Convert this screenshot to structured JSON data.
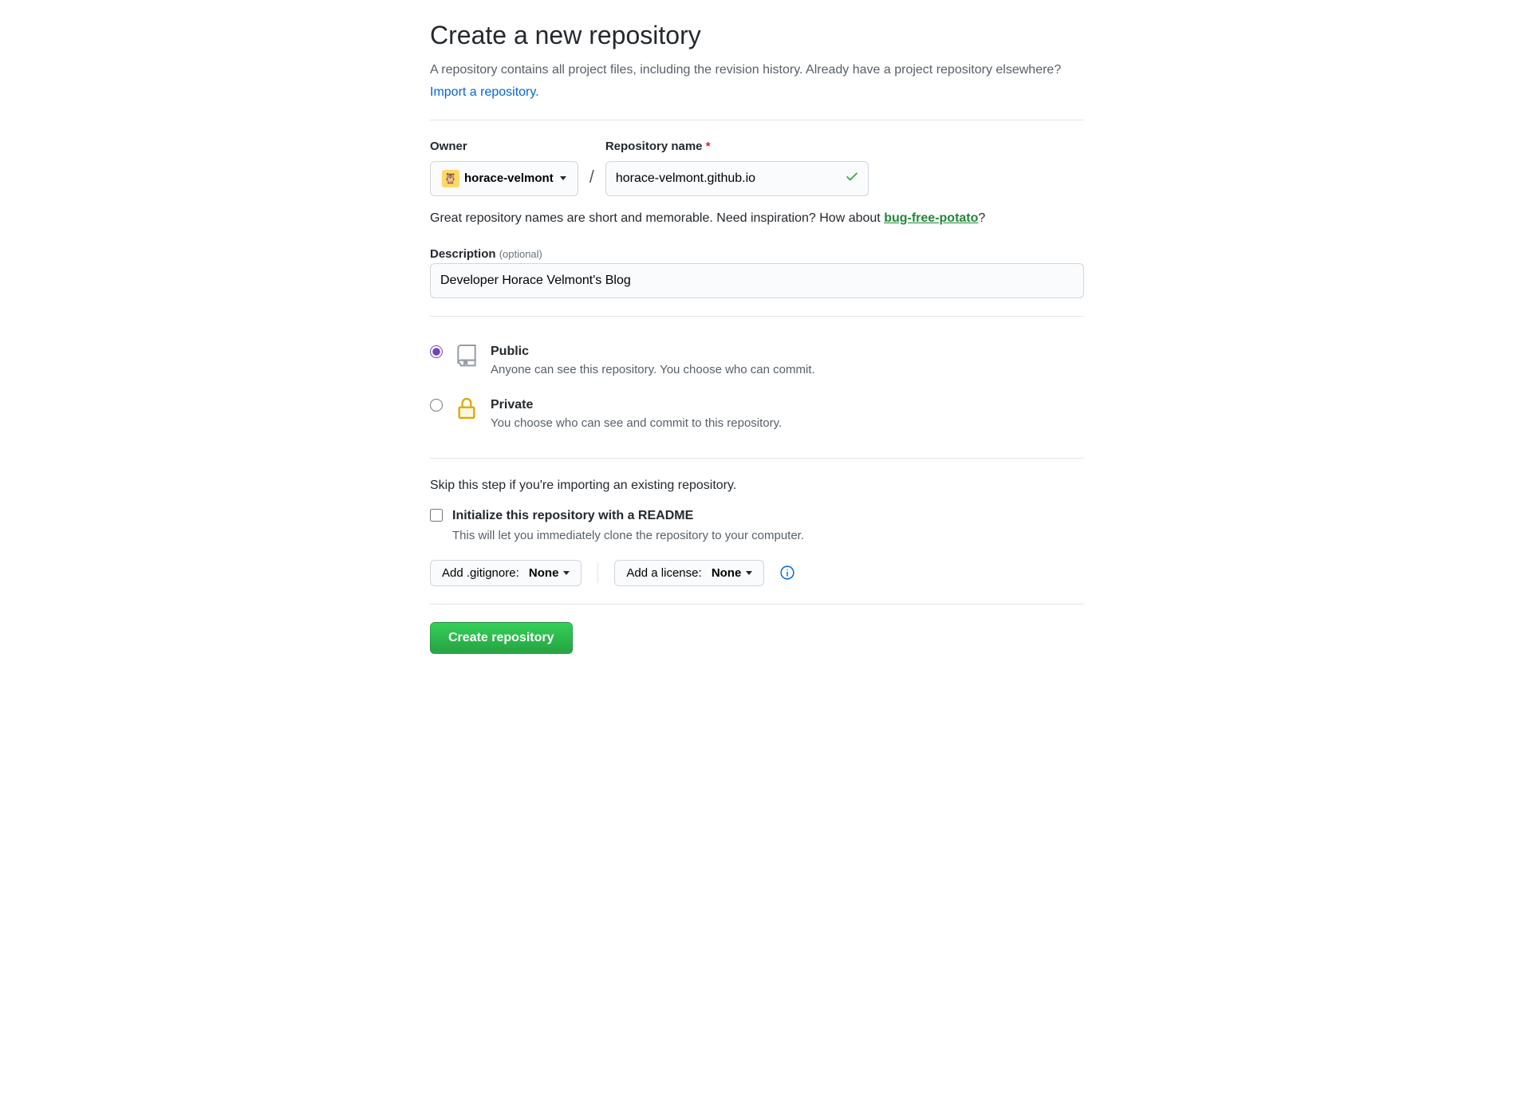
{
  "page": {
    "title": "Create a new repository",
    "subtitle": "A repository contains all project files, including the revision history. Already have a project repository elsewhere?",
    "import_link": "Import a repository."
  },
  "form": {
    "owner_label": "Owner",
    "owner_value": "horace-velmont",
    "repo_label": "Repository name",
    "repo_value": "horace-velmont.github.io",
    "hint_prefix": "Great repository names are short and memorable. Need inspiration? How about ",
    "suggestion": "bug-free-potato",
    "hint_suffix": "?",
    "desc_label": "Description",
    "desc_optional": "(optional)",
    "desc_value": "Developer Horace Velmont's Blog"
  },
  "visibility": {
    "public": {
      "title": "Public",
      "desc": "Anyone can see this repository. You choose who can commit."
    },
    "private": {
      "title": "Private",
      "desc": "You choose who can see and commit to this repository."
    }
  },
  "init": {
    "hint": "Skip this step if you're importing an existing repository.",
    "readme_label": "Initialize this repository with a README",
    "readme_desc": "This will let you immediately clone the repository to your computer.",
    "gitignore_label": "Add .gitignore:",
    "gitignore_value": "None",
    "license_label": "Add a license:",
    "license_value": "None"
  },
  "submit": {
    "label": "Create repository"
  }
}
